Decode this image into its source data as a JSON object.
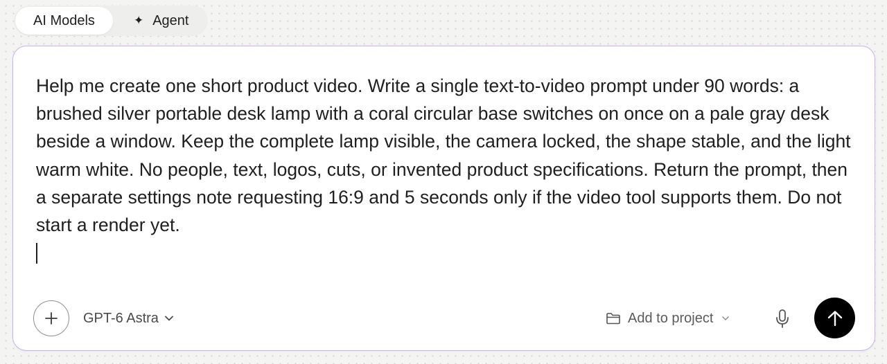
{
  "mode_tabs": [
    {
      "label": "AI Models",
      "active": true
    },
    {
      "label": "Agent",
      "active": false,
      "icon": "sparkle-icon"
    }
  ],
  "composer": {
    "prompt_text": "Help me create one short product video. Write a single text-to-video prompt under 90 words: a brushed silver portable desk lamp with a coral circular base switches on once on a pale gray desk beside a window. Keep the complete lamp visible, the camera locked, the shape stable, and the light warm white. No people, text, logos, cuts, or invented product specifications. Return the prompt, then a separate settings note requesting 16:9 and 5 seconds only if the video tool supports them. Do not start a render yet.",
    "toolbar": {
      "attach_icon": "plus-icon",
      "model_label": "GPT-6 Astra",
      "project_label": "Add to project",
      "project_icon": "folder-icon",
      "mic_icon": "microphone-icon",
      "send_icon": "arrow-up-icon"
    }
  },
  "colors": {
    "composer_border": "#c9b4ea",
    "send_button": "#000000",
    "text": "#1f1f1f"
  }
}
